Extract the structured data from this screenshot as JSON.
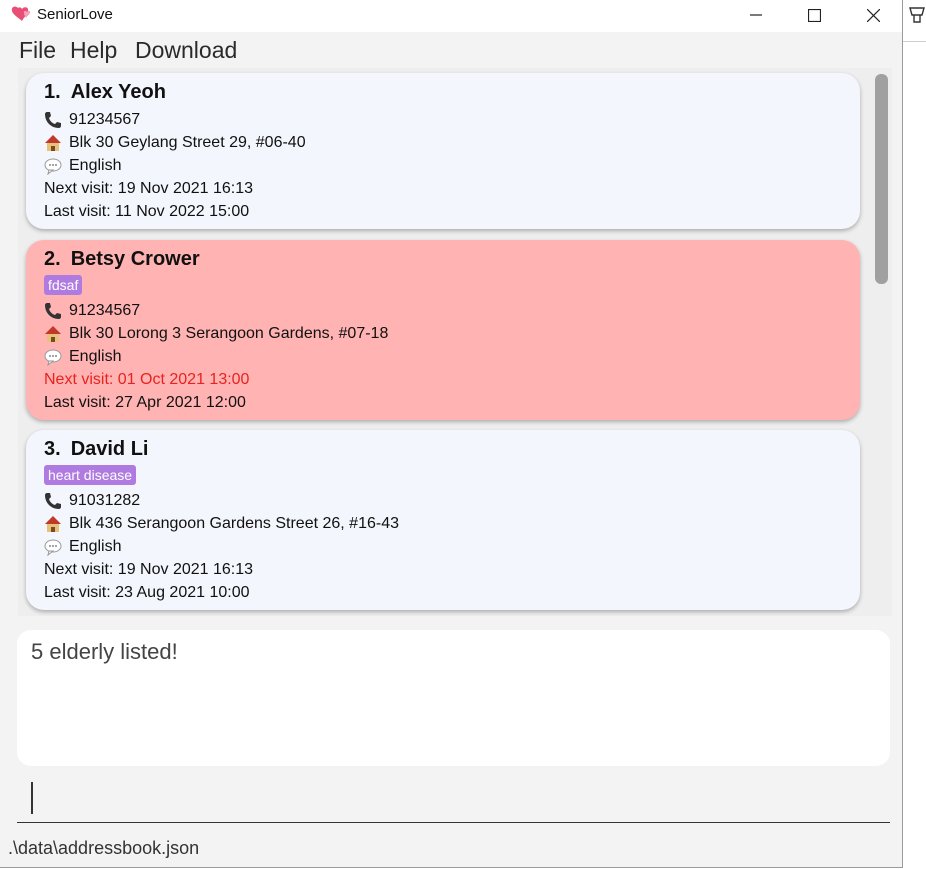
{
  "window": {
    "title": "SeniorLove"
  },
  "menu": [
    "File",
    "Help",
    "Download"
  ],
  "labels": {
    "next_visit": "Next visit: ",
    "last_visit": "Last visit: "
  },
  "persons": [
    {
      "index": "1.",
      "name": "Alex Yeoh",
      "tags": [],
      "phone": "91234567",
      "address": "Blk 30 Geylang Street 29, #06-40",
      "language": "English",
      "next_visit": "19 Nov 2021 16:13",
      "last_visit": "11 Nov 2022 15:00",
      "highlighted": false
    },
    {
      "index": "2.",
      "name": "Betsy Crower",
      "tags": [
        "fdsaf"
      ],
      "phone": "91234567",
      "address": "Blk 30 Lorong 3 Serangoon Gardens, #07-18",
      "language": "English",
      "next_visit": "01 Oct 2021 13:00",
      "last_visit": "27 Apr 2021 12:00",
      "highlighted": true
    },
    {
      "index": "3.",
      "name": "David Li",
      "tags": [
        "heart disease"
      ],
      "phone": "91031282",
      "address": "Blk 436 Serangoon Gardens Street 26, #16-43",
      "language": "English",
      "next_visit": "19 Nov 2021 16:13",
      "last_visit": "23 Aug 2021 10:00",
      "highlighted": false
    }
  ],
  "result": {
    "text": "5 elderly listed!"
  },
  "command": {
    "value": ""
  },
  "status": {
    "path": ".\\data\\addressbook.json"
  },
  "colors": {
    "card": "#f3f6fc",
    "highlight": "#ffb3b3",
    "tag": "#b07be0",
    "overdue": "#e8231f"
  }
}
